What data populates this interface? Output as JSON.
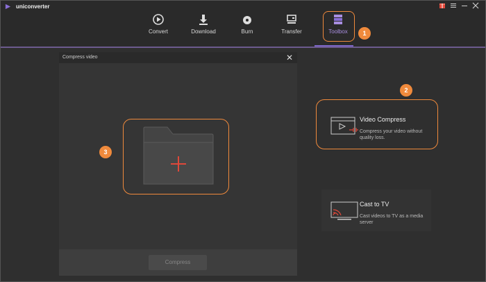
{
  "app": {
    "title": "uniconverter"
  },
  "nav": {
    "items": [
      {
        "label": "Convert"
      },
      {
        "label": "Download"
      },
      {
        "label": "Burn"
      },
      {
        "label": "Transfer"
      },
      {
        "label": "Toolbox"
      }
    ],
    "active": "Toolbox"
  },
  "window_controls": {
    "gift": "gift-icon",
    "menu": "menu-icon",
    "minimize": "minimize-icon",
    "close": "close-icon"
  },
  "callouts": [
    "1",
    "2",
    "3"
  ],
  "dialog": {
    "title": "Compress video",
    "compress_label": "Compress"
  },
  "tools": [
    {
      "title": "Video Compress",
      "desc": "Compress your video without quality loss."
    },
    {
      "title": "Cast to TV",
      "desc": "Cast videos to TV as a media server"
    }
  ],
  "colors": {
    "accent": "#7e68c8",
    "callout": "#f08a3c",
    "plus": "#e0483a"
  }
}
